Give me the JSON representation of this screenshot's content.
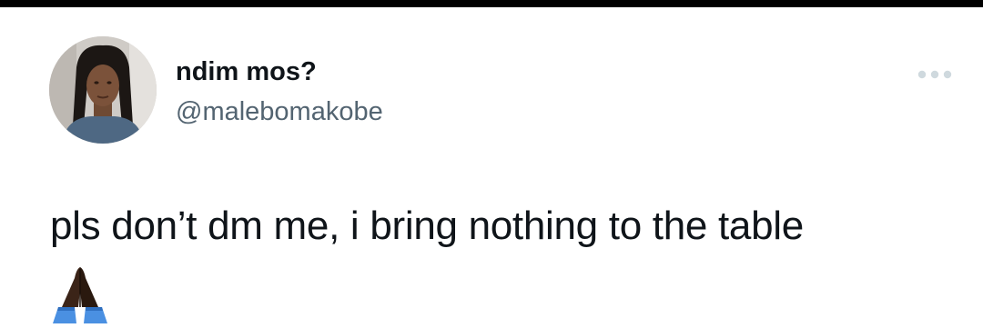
{
  "tweet": {
    "display_name": "ndim mos?",
    "handle": "@malebomakobe",
    "text": "pls don’t dm me, i bring nothing to the table",
    "emoji": "🙏🏿",
    "emoji_name": "folded-hands-dark-skin-tone",
    "more_icon": "more-horizontal-icon"
  },
  "colors": {
    "name": "#0f1419",
    "handle": "#536471",
    "text": "#0f1419",
    "more_icon": "#cfd9de",
    "top_bar": "#000000",
    "background": "#ffffff"
  }
}
